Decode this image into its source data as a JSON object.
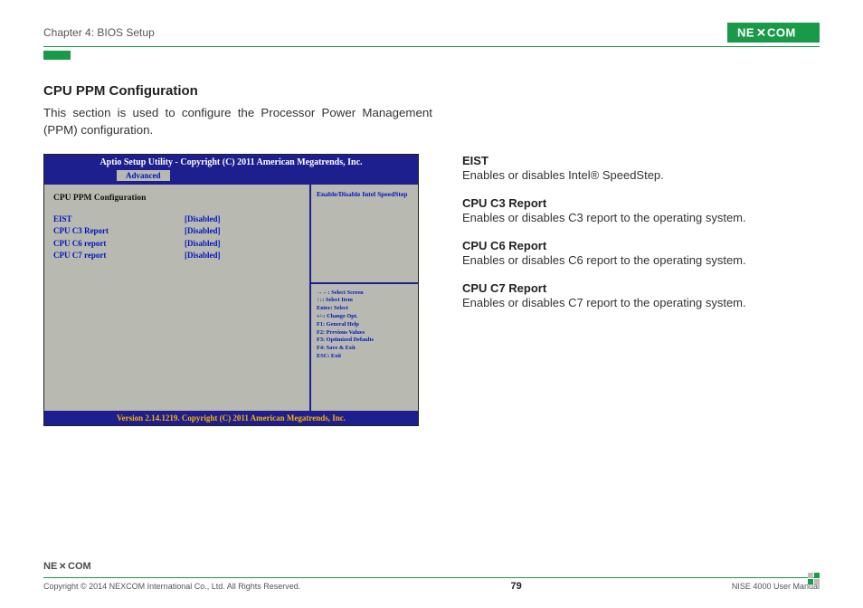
{
  "header": {
    "chapter": "Chapter 4: BIOS Setup",
    "brand": "NEXCOM"
  },
  "section": {
    "title": "CPU PPM Configuration",
    "desc": "This section is used to configure the Processor Power Management (PPM) configuration."
  },
  "bios": {
    "title": "Aptio Setup Utility - Copyright (C) 2011 American Megatrends, Inc.",
    "tab": "Advanced",
    "heading": "CPU PPM Configuration",
    "rows": [
      {
        "label": "EIST",
        "val": "[Disabled]"
      },
      {
        "label": "CPU C3 Report",
        "val": "[Disabled]"
      },
      {
        "label": "CPU C6 report",
        "val": "[Disabled]"
      },
      {
        "label": "CPU C7 report",
        "val": "[Disabled]"
      }
    ],
    "help_top": "Enable/Disable Intel SpeedStep",
    "help_keys": [
      "→←: Select Screen",
      "↑↓: Select Item",
      "Enter: Select",
      "+/-: Change Opt.",
      "F1: General Help",
      "F2: Previous Values",
      "F3: Optimized Defaults",
      "F4: Save & Exit",
      "ESC: Exit"
    ],
    "footer": "Version 2.14.1219. Copyright (C) 2011 American Megatrends, Inc."
  },
  "descriptions": [
    {
      "dt": "EIST",
      "dd": "Enables or disables Intel® SpeedStep."
    },
    {
      "dt": "CPU C3 Report",
      "dd": "Enables or disables C3 report to the operating system."
    },
    {
      "dt": "CPU C6 Report",
      "dd": "Enables or disables C6 report to the operating system."
    },
    {
      "dt": "CPU C7 Report",
      "dd": "Enables or disables C7 report to the operating system."
    }
  ],
  "footer": {
    "copyright": "Copyright © 2014 NEXCOM International Co., Ltd. All Rights Reserved.",
    "page": "79",
    "manual": "NISE 4000 User Manual"
  }
}
